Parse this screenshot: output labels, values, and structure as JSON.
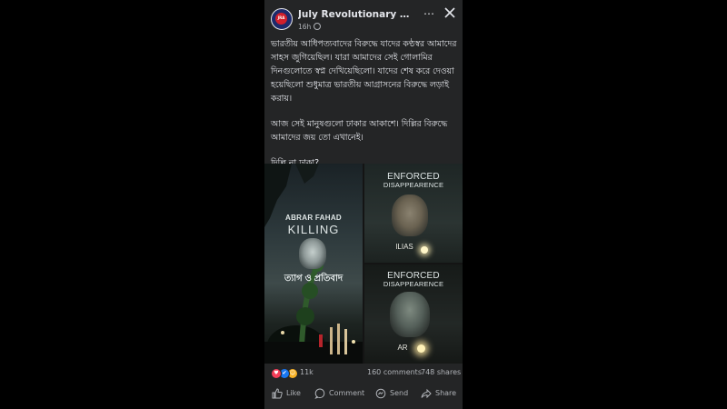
{
  "post": {
    "page_name": "July Revolutionary Alliance ...",
    "time": "16h",
    "more_icon": "more-dots-icon",
    "close_icon": "close-icon",
    "paragraphs": [
      "ভারতীয় আধিপত্যবাদের বিরুদ্ধে যাদের কণ্ঠস্বর আমাদের সাহস জুগিয়েছিল। যারা আমাদের সেই গোলামির দিনগুলোতে স্বপ্ন দেখিয়েছিলো। যাদের শেষ করে দেওয়া হয়েছিলো শুধুমাত্র ভারতীয় আগ্রাসনের বিরুদ্ধে লড়াই করায়।",
      "আজ সেই মানুষগুলো ঢাকার আকাশে। দিল্লির বিরুদ্ধে আমাদের জয় তো এখানেই।",
      "দিল্লি না ঢাকা?"
    ]
  },
  "media": {
    "image1": {
      "line1": "ABRAR FAHAD",
      "line2": "KILLING",
      "caption": "ত্যাগ ও প্রতিবাদ"
    },
    "image2": {
      "line1": "ENFORCED",
      "line2": "DISAPPEARENCE",
      "caption": "ILIAS"
    },
    "image3": {
      "line1": "ENFORCED",
      "line2": "DISAPPEARENCE",
      "caption": "AR"
    }
  },
  "reactions": {
    "icons": [
      "love",
      "like",
      "care"
    ],
    "count": "11k",
    "comments": "160 comments",
    "shares": "748 shares"
  },
  "actions": {
    "like": "Like",
    "comment": "Comment",
    "send": "Send",
    "share": "Share"
  },
  "colors": {
    "card_bg": "#242526",
    "text": "#e4e6eb",
    "muted": "#b0b3b8",
    "like_blue": "#1877f2",
    "love_red": "#f33e58",
    "care_yellow": "#f7b125"
  }
}
